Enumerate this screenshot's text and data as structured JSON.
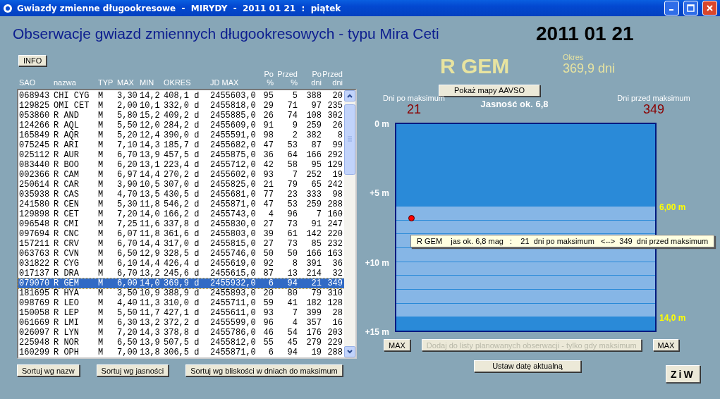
{
  "window": {
    "title": "Gwiazdy zmienne długookresowe  -  MIRYDY  -  2011 01 21  :  piątek"
  },
  "heading": "Obserwacje gwiazd zmiennych długookresowych - typu Mira Ceti",
  "date": "2011 01 21",
  "info_button": "INFO",
  "table": {
    "columns": [
      {
        "lines": [
          "SAO"
        ],
        "kind": "text"
      },
      {
        "lines": [
          "nazwa"
        ],
        "kind": "text"
      },
      {
        "lines": [
          "TYP"
        ],
        "kind": "text"
      },
      {
        "lines": [
          "MAX"
        ],
        "kind": "text"
      },
      {
        "lines": [
          "MIN"
        ],
        "kind": "text"
      },
      {
        "lines": [
          "OKRES"
        ],
        "kind": "text"
      },
      {
        "lines": [
          "JD MAX"
        ],
        "kind": "text"
      },
      {
        "lines": [
          "Po",
          "%"
        ],
        "kind": "number"
      },
      {
        "lines": [
          "Przed",
          "%"
        ],
        "kind": "number"
      },
      {
        "lines": [
          "Po",
          "dni"
        ],
        "kind": "number"
      },
      {
        "lines": [
          "Przed",
          "dni"
        ],
        "kind": "number"
      }
    ],
    "rows": [
      {
        "cells": [
          "068943",
          "CHI CYG",
          "M",
          "3,30",
          "14,2",
          "408,1 d",
          "2455603,0",
          "95",
          "5",
          "388",
          "20"
        ],
        "selected": false
      },
      {
        "cells": [
          "129825",
          "OMI CET",
          "M",
          "2,00",
          "10,1",
          "332,0 d",
          "2455818,0",
          "29",
          "71",
          "97",
          "235"
        ],
        "selected": false
      },
      {
        "cells": [
          "053860",
          "R AND",
          "M",
          "5,80",
          "15,2",
          "409,2 d",
          "2455885,0",
          "26",
          "74",
          "108",
          "302"
        ],
        "selected": false
      },
      {
        "cells": [
          "124266",
          "R AQL",
          "M",
          "5,50",
          "12,0",
          "284,2 d",
          "2455609,0",
          "91",
          "9",
          "259",
          "26"
        ],
        "selected": false
      },
      {
        "cells": [
          "165849",
          "R AQR",
          "M",
          "5,20",
          "12,4",
          "390,0 d",
          "2455591,0",
          "98",
          "2",
          "382",
          "8"
        ],
        "selected": false
      },
      {
        "cells": [
          "075245",
          "R ARI",
          "M",
          "7,10",
          "14,3",
          "185,7 d",
          "2455682,0",
          "47",
          "53",
          "87",
          "99"
        ],
        "selected": false
      },
      {
        "cells": [
          "025112",
          "R AUR",
          "M",
          "6,70",
          "13,9",
          "457,5 d",
          "2455875,0",
          "36",
          "64",
          "166",
          "292"
        ],
        "selected": false
      },
      {
        "cells": [
          "083440",
          "R BOO",
          "M",
          "6,20",
          "13,1",
          "223,4 d",
          "2455712,0",
          "42",
          "58",
          "95",
          "129"
        ],
        "selected": false
      },
      {
        "cells": [
          "002366",
          "R CAM",
          "M",
          "6,97",
          "14,4",
          "270,2 d",
          "2455602,0",
          "93",
          "7",
          "252",
          "19"
        ],
        "selected": false
      },
      {
        "cells": [
          "250614",
          "R CAR",
          "M",
          "3,90",
          "10,5",
          "307,0 d",
          "2455825,0",
          "21",
          "79",
          "65",
          "242"
        ],
        "selected": false
      },
      {
        "cells": [
          "035938",
          "R CAS",
          "M",
          "4,70",
          "13,5",
          "430,5 d",
          "2455681,0",
          "77",
          "23",
          "333",
          "98"
        ],
        "selected": false
      },
      {
        "cells": [
          "241580",
          "R CEN",
          "M",
          "5,30",
          "11,8",
          "546,2 d",
          "2455871,0",
          "47",
          "53",
          "259",
          "288"
        ],
        "selected": false
      },
      {
        "cells": [
          "129898",
          "R CET",
          "M",
          "7,20",
          "14,0",
          "166,2 d",
          "2455743,0",
          "4",
          "96",
          "7",
          "160"
        ],
        "selected": false
      },
      {
        "cells": [
          "096548",
          "R CMI",
          "M",
          "7,25",
          "11,6",
          "337,8 d",
          "2455830,0",
          "27",
          "73",
          "91",
          "247"
        ],
        "selected": false
      },
      {
        "cells": [
          "097694",
          "R CNC",
          "M",
          "6,07",
          "11,8",
          "361,6 d",
          "2455803,0",
          "39",
          "61",
          "142",
          "220"
        ],
        "selected": false
      },
      {
        "cells": [
          "157211",
          "R CRV",
          "M",
          "6,70",
          "14,4",
          "317,0 d",
          "2455815,0",
          "27",
          "73",
          "85",
          "232"
        ],
        "selected": false
      },
      {
        "cells": [
          "063763",
          "R CVN",
          "M",
          "6,50",
          "12,9",
          "328,5 d",
          "2455746,0",
          "50",
          "50",
          "166",
          "163"
        ],
        "selected": false
      },
      {
        "cells": [
          "031822",
          "R CYG",
          "M",
          "6,10",
          "14,4",
          "426,4 d",
          "2455619,0",
          "92",
          "8",
          "391",
          "36"
        ],
        "selected": false
      },
      {
        "cells": [
          "017137",
          "R DRA",
          "M",
          "6,70",
          "13,2",
          "245,6 d",
          "2455615,0",
          "87",
          "13",
          "214",
          "32"
        ],
        "selected": false
      },
      {
        "cells": [
          "079070",
          "R GEM",
          "M",
          "6,00",
          "14,0",
          "369,9 d",
          "2455932,0",
          "6",
          "94",
          "21",
          "349"
        ],
        "selected": true
      },
      {
        "cells": [
          "181695",
          "R HYA",
          "M",
          "3,50",
          "10,9",
          "388,9 d",
          "2455893,0",
          "20",
          "80",
          "79",
          "310"
        ],
        "selected": false
      },
      {
        "cells": [
          "098769",
          "R LEO",
          "M",
          "4,40",
          "11,3",
          "310,0 d",
          "2455711,0",
          "59",
          "41",
          "182",
          "128"
        ],
        "selected": false
      },
      {
        "cells": [
          "150058",
          "R LEP",
          "M",
          "5,50",
          "11,7",
          "427,1 d",
          "2455611,0",
          "93",
          "7",
          "399",
          "28"
        ],
        "selected": false
      },
      {
        "cells": [
          "061669",
          "R LMI",
          "M",
          "6,30",
          "13,2",
          "372,2 d",
          "2455599,0",
          "96",
          "4",
          "357",
          "16"
        ],
        "selected": false
      },
      {
        "cells": [
          "026097",
          "R LYN",
          "M",
          "7,20",
          "14,3",
          "378,8 d",
          "2455786,0",
          "46",
          "54",
          "176",
          "203"
        ],
        "selected": false
      },
      {
        "cells": [
          "225948",
          "R NOR",
          "M",
          "6,50",
          "13,9",
          "507,5 d",
          "2455812,0",
          "55",
          "45",
          "279",
          "229"
        ],
        "selected": false
      },
      {
        "cells": [
          "160299",
          "R OPH",
          "M",
          "7,00",
          "13,8",
          "306,5 d",
          "2455871,0",
          "6",
          "94",
          "19",
          "288"
        ],
        "selected": false
      }
    ]
  },
  "sort_buttons": [
    "Sortuj wg nazw",
    "Sortuj wg jasności",
    "Sortuj wg bliskości w dniach do maksimum"
  ],
  "star": {
    "name": "R GEM",
    "period_label": "Okres",
    "period": "369,9 dni",
    "maps_button": "Pokaż mapy AAVSO",
    "days_after_label": "Dni po maksimum",
    "days_after": "21",
    "brightness": "Jasność ok. 6,8",
    "days_before_label": "Dni przed maksimum",
    "days_before": "349"
  },
  "gauge": {
    "scale_labels": [
      "0 m",
      "+5 m",
      "+10 m",
      "+15 m"
    ],
    "range_top": {
      "label": "6,00 m"
    },
    "range_bottom": {
      "label": "14,0 m"
    }
  },
  "tooltip": "R GEM    jas ok. 6,8 mag   :    21  dni po maksimum   <-->  349  dni przed maksimum",
  "bottom_buttons": [
    {
      "label": "MAX",
      "disabled": false
    },
    {
      "label": "Dodaj do listy planowanych obserwacji - tylko gdy maksimum",
      "disabled": true
    },
    {
      "label": "MAX",
      "disabled": false
    }
  ],
  "date_button": "Ustaw datę aktualną",
  "ziw_button": "ZiW"
}
